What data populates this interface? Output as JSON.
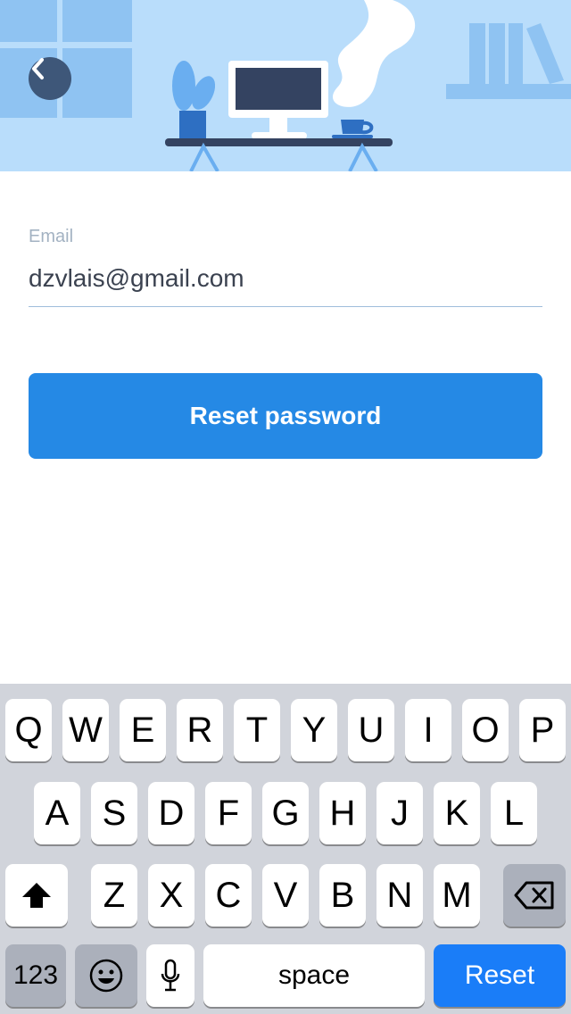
{
  "header": {
    "back_icon": "chevron-left-icon",
    "illustration": "desk-workspace-illustration"
  },
  "form": {
    "email_label": "Email",
    "email_value": "dzvlais@gmail.com",
    "submit_label": "Reset password"
  },
  "keyboard": {
    "row1": [
      "Q",
      "W",
      "E",
      "R",
      "T",
      "Y",
      "U",
      "I",
      "O",
      "P"
    ],
    "row2": [
      "A",
      "S",
      "D",
      "F",
      "G",
      "H",
      "J",
      "K",
      "L"
    ],
    "row3": [
      "Z",
      "X",
      "C",
      "V",
      "B",
      "N",
      "M"
    ],
    "numbers_label": "123",
    "space_label": "space",
    "return_label": "Reset",
    "shift_icon": "shift-icon",
    "delete_icon": "delete-icon",
    "emoji_icon": "emoji-icon",
    "mic_icon": "microphone-icon"
  },
  "colors": {
    "header_bg": "#b9ddfb",
    "primary": "#2589e5",
    "return_key": "#1a7df8",
    "back_button": "#3e5779"
  }
}
